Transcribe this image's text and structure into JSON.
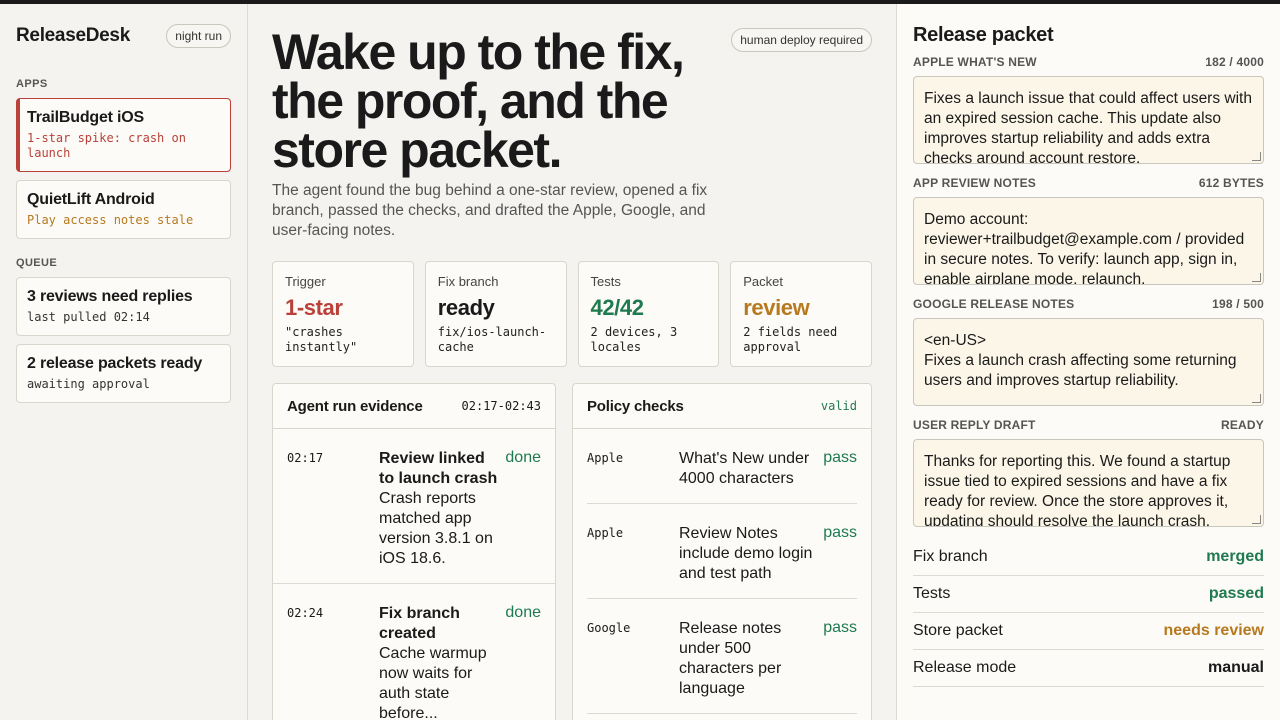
{
  "sidebar": {
    "brand": "ReleaseDesk",
    "mode": "night run",
    "apps_label": "APPS",
    "apps": [
      {
        "name": "TrailBudget iOS",
        "note": "1-star spike: crash on launch"
      },
      {
        "name": "QuietLift Android",
        "note": "Play access notes stale"
      }
    ],
    "queue_label": "QUEUE",
    "queue": [
      {
        "name": "3 reviews need replies",
        "note": "last pulled 02:14"
      },
      {
        "name": "2 release packets ready",
        "note": "awaiting approval"
      }
    ]
  },
  "hero": {
    "title": "Wake up to the fix, the proof, and the store packet.",
    "description": "The agent found the bug behind a one-star review, opened a fix branch, passed the checks, and drafted the Apple, Google, and user-facing notes.",
    "deploy_badge": "human deploy required"
  },
  "stats": [
    {
      "label": "Trigger",
      "value": "1-star",
      "note": "\"crashes instantly\""
    },
    {
      "label": "Fix branch",
      "value": "ready",
      "note": "fix/ios-launch-cache"
    },
    {
      "label": "Tests",
      "value": "42/42",
      "note": "2 devices, 3 locales"
    },
    {
      "label": "Packet",
      "value": "review",
      "note": "2 fields need approval"
    }
  ],
  "evidence": {
    "title": "Agent run evidence",
    "range": "02:17-02:43",
    "rows": [
      {
        "time": "02:17",
        "title": "Review linked to launch crash",
        "text": "Crash reports matched app version 3.8.1 on iOS 18.6.",
        "status": "done"
      },
      {
        "time": "02:24",
        "title": "Fix branch created",
        "text": "Cache warmup now waits for auth state before...",
        "status": "done"
      }
    ]
  },
  "policy": {
    "title": "Policy checks",
    "status": "valid",
    "rows": [
      {
        "store": "Apple",
        "text": "What's New under 4000 characters",
        "status": "pass"
      },
      {
        "store": "Apple",
        "text": "Review Notes include demo login and test path",
        "status": "pass"
      },
      {
        "store": "Google",
        "text": "Release notes under 500 characters per language",
        "status": "pass"
      }
    ]
  },
  "packet": {
    "title": "Release packet",
    "fields": [
      {
        "label": "APPLE WHAT'S NEW",
        "meta": "182 / 4000",
        "value": "Fixes a launch issue that could affect users with an expired session cache. This update also improves startup reliability and adds extra checks around account restore."
      },
      {
        "label": "APP REVIEW NOTES",
        "meta": "612 BYTES",
        "value": "Demo account: reviewer+trailbudget@example.com / provided in secure notes. To verify: launch app, sign in, enable airplane mode, relaunch."
      },
      {
        "label": "GOOGLE RELEASE NOTES",
        "meta": "198 / 500",
        "value": "<en-US>\nFixes a launch crash affecting some returning users and improves startup reliability."
      },
      {
        "label": "USER REPLY DRAFT",
        "meta": "READY",
        "value": "Thanks for reporting this. We found a startup issue tied to expired sessions and have a fix ready for review. Once the store approves it, updating should resolve the launch crash."
      }
    ],
    "statuses": [
      {
        "label": "Fix branch",
        "value": "merged"
      },
      {
        "label": "Tests",
        "value": "passed"
      },
      {
        "label": "Store packet",
        "value": "needs review"
      },
      {
        "label": "Release mode",
        "value": "manual"
      }
    ]
  },
  "colors": {
    "accent_red": "#b9413a",
    "green": "#1f7a4f",
    "amber": "#b7791f"
  }
}
